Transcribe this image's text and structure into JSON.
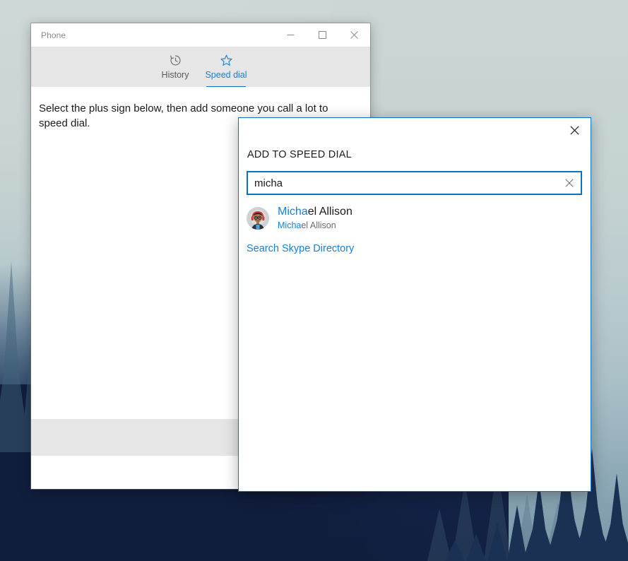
{
  "window": {
    "title": "Phone",
    "controls": {
      "minimize": "minimize-button",
      "maximize": "maximize-button",
      "close": "close-button"
    },
    "tabs": [
      {
        "label": "History",
        "icon": "history-icon",
        "active": false
      },
      {
        "label": "Speed dial",
        "icon": "star-icon",
        "active": true
      }
    ],
    "hint_text": "Select the plus sign below, then add someone you call a lot to speed dial."
  },
  "dialog": {
    "heading": "ADD TO SPEED DIAL",
    "close_icon": "close-icon",
    "search": {
      "value": "micha",
      "placeholder": "Search",
      "clear_icon": "clear-icon"
    },
    "results": [
      {
        "avatar": "avatar-michael-allison",
        "name_match": "Micha",
        "name_rest": "el Allison",
        "name_full": "Michael Allison",
        "sub_match": "Micha",
        "sub_rest": "el Allison",
        "sub_full": "Michael Allison"
      }
    ],
    "directory_link": "Search Skype Directory"
  },
  "colors": {
    "accent_blue": "#0a72c4",
    "link_blue": "#1a7fd4",
    "tab_strip_bg": "#e6e6e6",
    "command_bar_bg": "#e6e6e6",
    "text_primary": "#1b1b1b",
    "text_secondary": "#6b6b6b",
    "title_gray": "#8a8a8a"
  }
}
